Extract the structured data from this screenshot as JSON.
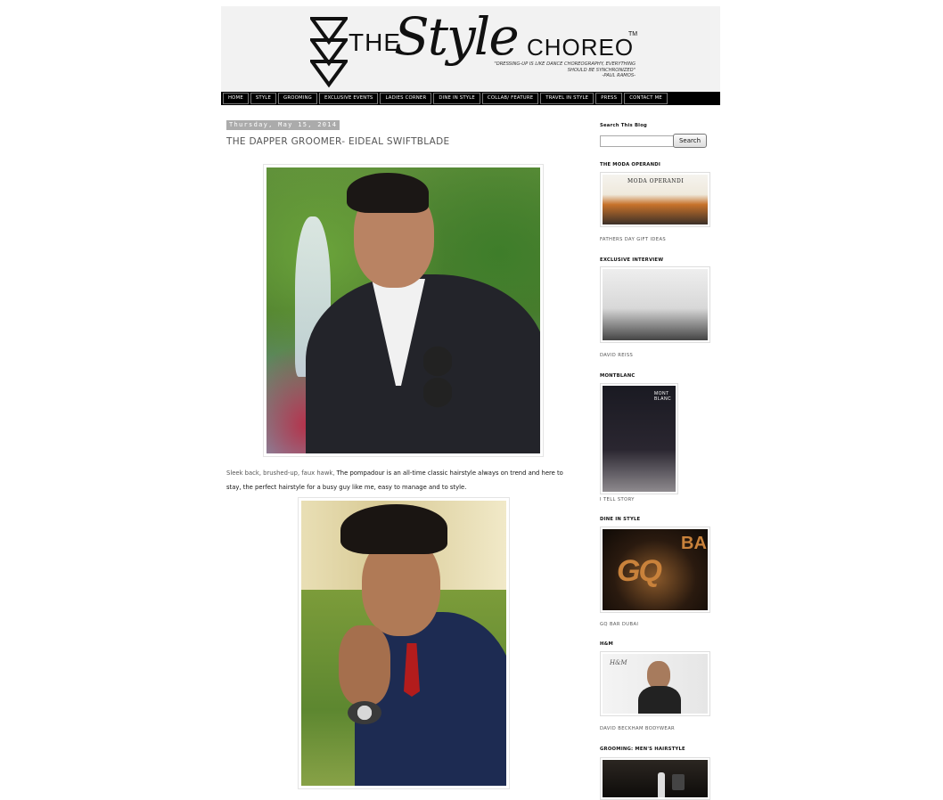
{
  "header": {
    "logo_the": "THE",
    "logo_style": "Style",
    "logo_choreo": "CHOREO",
    "logo_tm": "TM",
    "tagline": "\"DRESSING-UP IS LIKE DANCE CHOREOGRAPHY, EVERYTHING SHOULD BE SYNCHRONIZED\"",
    "attribution": "-PAUL RAMOS-"
  },
  "nav": {
    "items": [
      "HOME",
      "STYLE",
      "GROOMING",
      "EXCLUSIVE EVENTS",
      "LADIES CORNER",
      "DINE IN STYLE",
      "COLLAB/ FEATURE",
      "TRAVEL IN STYLE",
      "PRESS",
      "CONTACT ME"
    ]
  },
  "post": {
    "date": "Thursday, May 15, 2014",
    "title": "THE DAPPER GROOMER- EIDEAL SWIFTBLADE",
    "caption_lead": "Sleek back, brushed-up, faux hawk,",
    "caption_body": " The pompadour is an all-time classic hairstyle always on trend and here to stay, the perfect hairstyle for a busy guy like me, easy to manage and to style."
  },
  "sidebar": {
    "search_heading": "Search This Blog",
    "search_button": "Search",
    "search_placeholder": "",
    "widgets": [
      {
        "heading": "THE MODA OPERANDI",
        "caption": "FATHERS DAY GIFT IDEAS",
        "image_text": "MODA OPERANDI"
      },
      {
        "heading": "EXCLUSIVE INTERVIEW",
        "caption": "DAVID REISS"
      },
      {
        "heading": "MONTBLANC",
        "caption": "I TELL STORY",
        "image_text": "MONT BLANC"
      },
      {
        "heading": "DINE IN STYLE",
        "caption": "GQ BAR DUBAI",
        "image_text_1": "GQ",
        "image_text_2": "BAR"
      },
      {
        "heading": "H&M",
        "caption": "DAVID BECKHAM BODYWEAR",
        "image_text": "H&M"
      },
      {
        "heading": "GROOMING: MEN'S HAIRSTYLE"
      }
    ]
  }
}
